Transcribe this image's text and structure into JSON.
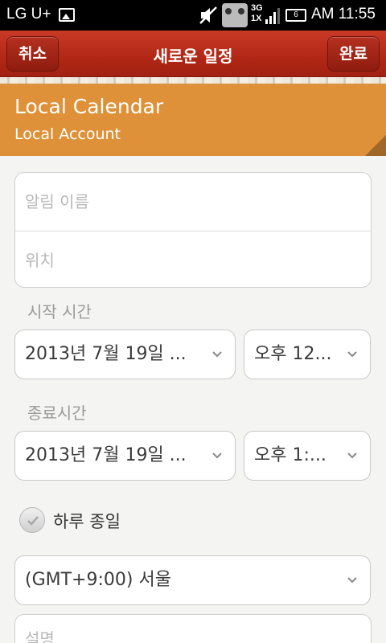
{
  "status": {
    "carrier": "LG U+",
    "network_top": "3G",
    "network_bottom": "1X",
    "battery": "6",
    "time": "AM 11:55"
  },
  "action_bar": {
    "cancel": "취소",
    "title": "새로운 일정",
    "done": "완료"
  },
  "calendar": {
    "name": "Local Calendar",
    "account": "Local Account",
    "color": "#de9138"
  },
  "form": {
    "event_name_placeholder": "알림 이름",
    "location_placeholder": "위치",
    "start_label": "시작 시간",
    "start_date": "2013년 7월 19일 ...",
    "start_time": "오후 12...",
    "end_label": "종료시간",
    "end_date": "2013년 7월 19일 ...",
    "end_time": "오후 1:...",
    "all_day_label": "하루 종일",
    "timezone": "(GMT+9:00) 서울",
    "description_placeholder": "설명"
  },
  "icons": [
    "image-icon",
    "mute-icon",
    "game-icon",
    "signal-icon",
    "battery-icon",
    "chevron-down-icon",
    "check-icon"
  ],
  "colors": {
    "action_bar": "#b02615",
    "calendar_header": "#de9138",
    "background": "#f4f4f2"
  }
}
